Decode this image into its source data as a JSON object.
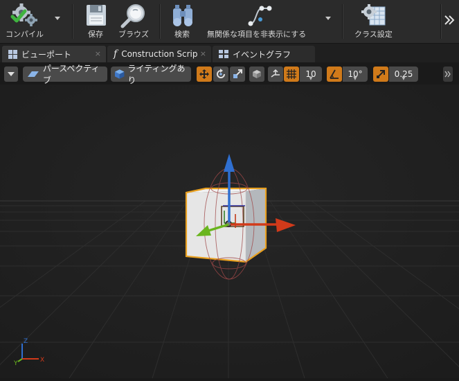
{
  "toolbar": {
    "compile_label": "コンパイル",
    "save_label": "保存",
    "browse_label": "ブラウズ",
    "search_label": "検索",
    "hide_unrelated_label": "無関係な項目を非表示にする",
    "class_settings_label": "クラス設定"
  },
  "tabs": [
    {
      "label": "ビューポート",
      "close": "×"
    },
    {
      "label": "Construction Scrip",
      "close": "×"
    },
    {
      "label": "イベントグラフ",
      "close": "×"
    }
  ],
  "viewport_toolbar": {
    "perspective_label": "パースペクティブ",
    "lighting_label": "ライティングあり",
    "grid_snap_value": "10",
    "rotation_snap_value": "10°",
    "scale_snap_value": "0.25"
  },
  "axis_labels": {
    "x": "X",
    "y": "Y",
    "z": "Z"
  },
  "colors": {
    "accent": "#d07a1a",
    "x_axis": "#d23a1a",
    "y_axis": "#6ab51e",
    "z_axis": "#2f6fd0",
    "selection": "#e8a020"
  }
}
